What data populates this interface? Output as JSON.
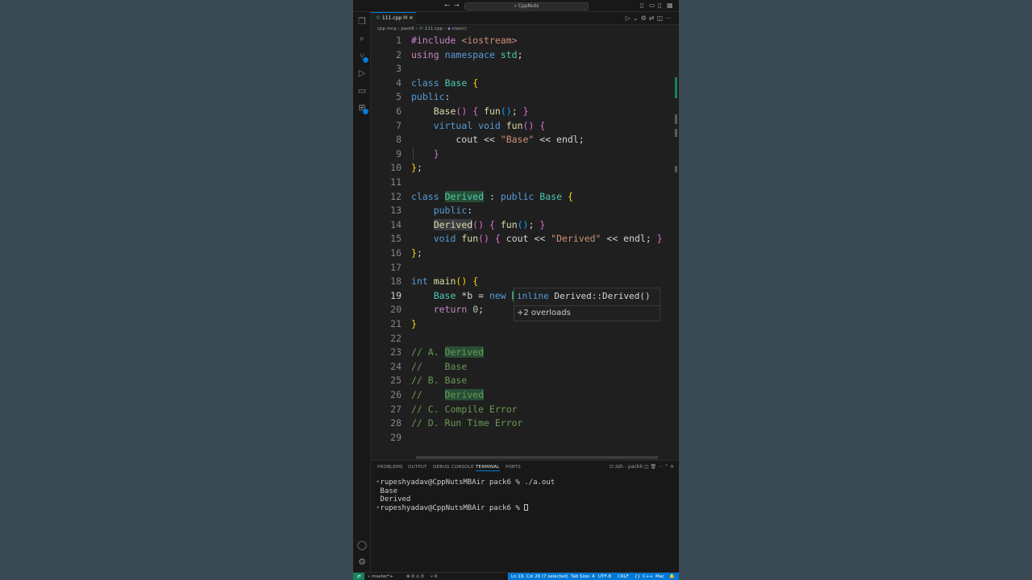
{
  "window": {
    "command_center": "CppNuts"
  },
  "tab": {
    "name": "111.cpp",
    "modified": "M"
  },
  "breadcrumb": [
    "cpp mcq",
    "pack6",
    "111.cpp",
    "main()"
  ],
  "editor": {
    "current_line": 19,
    "lines": [
      [
        {
          "t": "#include ",
          "c": "pp"
        },
        {
          "t": "<iostream>",
          "c": "st"
        }
      ],
      [
        {
          "t": "using",
          "c": "pp"
        },
        {
          "t": " "
        },
        {
          "t": "namespace",
          "c": "kw"
        },
        {
          "t": " "
        },
        {
          "t": "std",
          "c": "ty"
        },
        {
          "t": ";"
        }
      ],
      [],
      [
        {
          "t": "class",
          "c": "kw"
        },
        {
          "t": " "
        },
        {
          "t": "Base",
          "c": "ty"
        },
        {
          "t": " "
        },
        {
          "t": "{",
          "c": "br1"
        }
      ],
      [
        {
          "t": "public",
          "c": "kw"
        },
        {
          "t": ":"
        }
      ],
      [
        {
          "t": "    "
        },
        {
          "t": "Base",
          "c": "fn"
        },
        {
          "t": "()",
          "c": "br2"
        },
        {
          "t": " "
        },
        {
          "t": "{",
          "c": "br2"
        },
        {
          "t": " "
        },
        {
          "t": "fun",
          "c": "fn"
        },
        {
          "t": "()",
          "c": "br3"
        },
        {
          "t": "; "
        },
        {
          "t": "}",
          "c": "br2"
        }
      ],
      [
        {
          "t": "    "
        },
        {
          "t": "virtual",
          "c": "kw"
        },
        {
          "t": " "
        },
        {
          "t": "void",
          "c": "kw"
        },
        {
          "t": " "
        },
        {
          "t": "fun",
          "c": "fn"
        },
        {
          "t": "()",
          "c": "br2"
        },
        {
          "t": " "
        },
        {
          "t": "{",
          "c": "br2"
        }
      ],
      [
        {
          "t": "        cout << "
        },
        {
          "t": "\"Base\"",
          "c": "st"
        },
        {
          "t": " << endl;"
        }
      ],
      [
        {
          "t": "    "
        },
        {
          "t": "}",
          "c": "br2"
        }
      ],
      [
        {
          "t": "}",
          "c": "br1"
        },
        {
          "t": ";"
        }
      ],
      [],
      [
        {
          "t": "class",
          "c": "kw"
        },
        {
          "t": " "
        },
        {
          "t": "Derived",
          "c": "ty",
          "h": "hl"
        },
        {
          "t": " : "
        },
        {
          "t": "public",
          "c": "kw"
        },
        {
          "t": " "
        },
        {
          "t": "Base",
          "c": "ty"
        },
        {
          "t": " "
        },
        {
          "t": "{",
          "c": "br1"
        }
      ],
      [
        {
          "t": "    "
        },
        {
          "t": "public",
          "c": "kw"
        },
        {
          "t": ":"
        }
      ],
      [
        {
          "t": "    "
        },
        {
          "t": "Derived",
          "c": "fn",
          "h": "hl2"
        },
        {
          "t": "()",
          "c": "br2"
        },
        {
          "t": " "
        },
        {
          "t": "{",
          "c": "br2"
        },
        {
          "t": " "
        },
        {
          "t": "fun",
          "c": "fn"
        },
        {
          "t": "()",
          "c": "br3"
        },
        {
          "t": "; "
        },
        {
          "t": "}",
          "c": "br2"
        }
      ],
      [
        {
          "t": "    "
        },
        {
          "t": "void",
          "c": "kw"
        },
        {
          "t": " "
        },
        {
          "t": "fun",
          "c": "fn"
        },
        {
          "t": "()",
          "c": "br2"
        },
        {
          "t": " "
        },
        {
          "t": "{",
          "c": "br2"
        },
        {
          "t": " cout << "
        },
        {
          "t": "\"Derived\"",
          "c": "st"
        },
        {
          "t": " << endl; "
        },
        {
          "t": "}",
          "c": "br2"
        }
      ],
      [
        {
          "t": "}",
          "c": "br1"
        },
        {
          "t": ";"
        }
      ],
      [],
      [
        {
          "t": "int",
          "c": "kw"
        },
        {
          "t": " "
        },
        {
          "t": "main",
          "c": "fn"
        },
        {
          "t": "()",
          "c": "br1"
        },
        {
          "t": " "
        },
        {
          "t": "{",
          "c": "br1"
        }
      ],
      [
        {
          "t": "    "
        },
        {
          "t": "Base",
          "c": "ty"
        },
        {
          "t": " *b = "
        },
        {
          "t": "new",
          "c": "kw"
        },
        {
          "t": " "
        },
        {
          "t": "Derived",
          "c": "ty",
          "h": "hl"
        },
        {
          "t": "()",
          "c": "br2"
        },
        {
          "t": ";"
        }
      ],
      [
        {
          "t": "    "
        },
        {
          "t": "return",
          "c": "pp"
        },
        {
          "t": " "
        },
        {
          "t": "0",
          "c": "nu"
        },
        {
          "t": ";"
        }
      ],
      [
        {
          "t": "}",
          "c": "br1"
        }
      ],
      [],
      [
        {
          "t": "// A. ",
          "c": "cm"
        },
        {
          "t": "Derived",
          "c": "cm",
          "h": "hl"
        }
      ],
      [
        {
          "t": "//    Base",
          "c": "cm"
        }
      ],
      [
        {
          "t": "// B. Base",
          "c": "cm"
        }
      ],
      [
        {
          "t": "//    ",
          "c": "cm"
        },
        {
          "t": "Derived",
          "c": "cm",
          "h": "hl"
        }
      ],
      [
        {
          "t": "// C. Compile Error",
          "c": "cm"
        }
      ],
      [
        {
          "t": "// D. Run Time Error",
          "c": "cm"
        }
      ],
      []
    ]
  },
  "hover": {
    "signature_kw": "inline",
    "signature": " Derived::Derived()",
    "overloads": "+2 overloads"
  },
  "panel": {
    "tabs": [
      "PROBLEMS",
      "OUTPUT",
      "DEBUG CONSOLE",
      "TERMINAL",
      "PORTS"
    ],
    "active_tab": "TERMINAL",
    "shell_label": "zsh - pack6",
    "terminal_lines": [
      "rupeshyadav@CppNutsMBAir pack6 % ./a.out",
      "Base",
      "Derived",
      "rupeshyadav@CppNutsMBAir pack6 % "
    ]
  },
  "statusbar": {
    "branch": "master*+",
    "problems": "⊗ 0 ⚠ 0",
    "ports": "⑂ 0",
    "position": "Ln 19, Col 26 (7 selected)",
    "tab_size": "Tab Size: 4",
    "encoding": "UTF-8",
    "eol": "CRLF",
    "language": "C++",
    "platform": "Mac"
  },
  "colors": {
    "accent": "#0078d4",
    "editor_bg": "#1f1f1f",
    "remote": "#16825d"
  }
}
